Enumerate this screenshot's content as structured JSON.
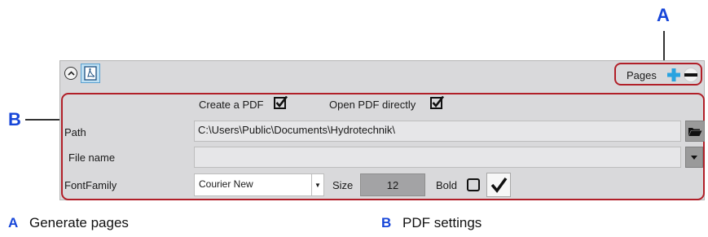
{
  "callouts": {
    "a": "A",
    "b": "B"
  },
  "toolbar": {
    "collapse_icon": "chevron-up-icon",
    "pdf_icon": "pdf-icon",
    "pages_label": "Pages",
    "add_icon": "plus-icon",
    "remove_icon": "minus-icon"
  },
  "pdf": {
    "create_label": "Create a PDF",
    "create_checked": true,
    "open_label": "Open PDF directly",
    "open_checked": true,
    "path_label": "Path",
    "path_value": "C:\\Users\\Public\\Documents\\Hydrotechnik\\",
    "path_browse_icon": "folder-open-icon",
    "filename_label": "File name",
    "filename_value": "",
    "filename_dropdown_icon": "dropdown-arrow-icon",
    "font_family_label": "FontFamily",
    "font_family_value": "Courier New",
    "size_label": "Size",
    "size_value": "12",
    "bold_label": "Bold",
    "bold_checked": false,
    "confirm_icon": "checkmark-icon"
  },
  "legend": [
    {
      "key": "A",
      "text": "Generate pages"
    },
    {
      "key": "B",
      "text": "PDF settings"
    }
  ],
  "colors": {
    "callout": "#1746d9",
    "highlight_border": "#b11f28",
    "panel_bg": "#d9d9db",
    "plus_icon": "#29a3e0"
  }
}
